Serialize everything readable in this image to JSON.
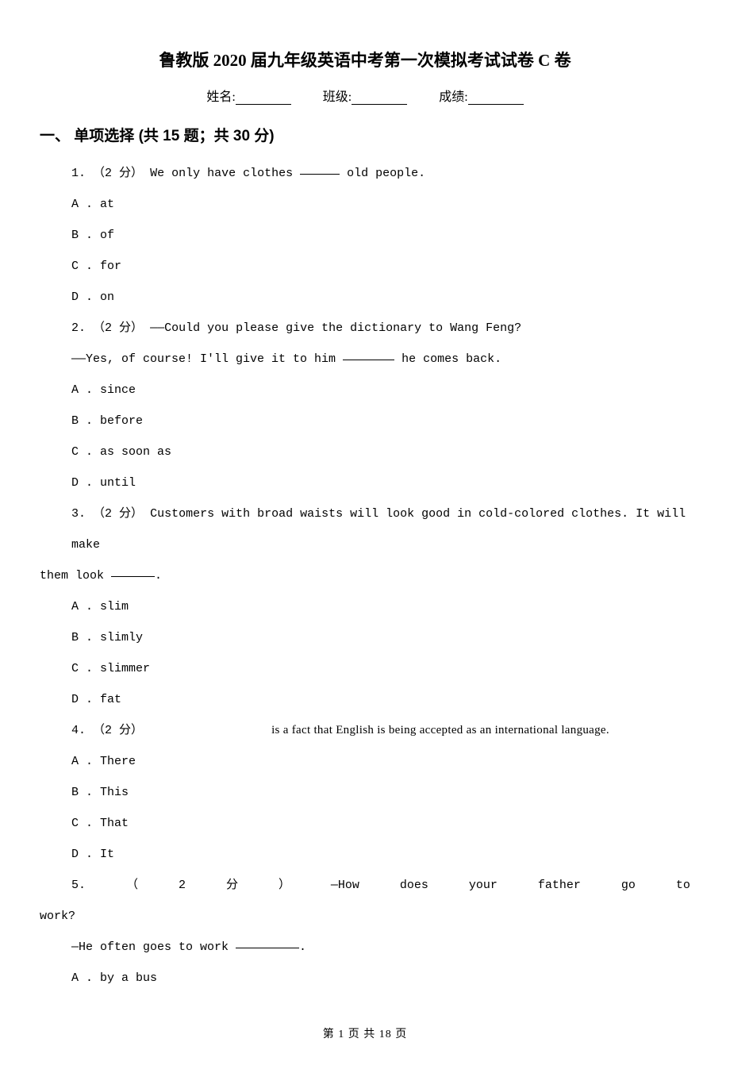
{
  "title": "鲁教版 2020 届九年级英语中考第一次模拟考试试卷 C 卷",
  "info": {
    "name_label": "姓名:",
    "class_label": "班级:",
    "score_label": "成绩:"
  },
  "section": {
    "number": "一、",
    "title": "单项选择 (共 15 题；共 30 分)"
  },
  "questions": [
    {
      "num": "1.",
      "points": "（2 分）",
      "text_before": "We only have clothes ",
      "text_after": " old people.",
      "options": {
        "a": "A . at",
        "b": "B . of",
        "c": "C . for",
        "d": "D . on"
      }
    },
    {
      "num": "2.",
      "points": "（2 分）",
      "text": "——Could you please give the dictionary to Wang Feng?",
      "line2_before": "——Yes, of course! I'll give it to him ",
      "line2_after": " he comes back.",
      "options": {
        "a": "A . since",
        "b": "B . before",
        "c": "C . as soon as",
        "d": "D . until"
      }
    },
    {
      "num": "3.",
      "points": "（2 分）",
      "text": "Customers with broad waists will look good in cold-colored clothes. It will make",
      "line2_before": "them look ",
      "line2_after": ".",
      "options": {
        "a": "A . slim",
        "b": "B . slimly",
        "c": "C . slimmer",
        "d": "D . fat"
      }
    },
    {
      "num": "4.",
      "points": "（2 分）",
      "text": "is a fact that English is being accepted as an international language.",
      "options": {
        "a": "A . There",
        "b": "B . This",
        "c": "C . That",
        "d": "D . It"
      }
    },
    {
      "num": "5.",
      "points_open": "（",
      "points_num": "2",
      "points_unit": "分",
      "points_close": "）",
      "w1": "—How",
      "w2": "does",
      "w3": "your",
      "w4": "father",
      "w5": "go",
      "w6": "to",
      "line2": "work?",
      "line3_before": "—He often goes to work ",
      "line3_after": ".",
      "options": {
        "a": "A . by a bus"
      }
    }
  ],
  "footer": {
    "prefix": "第 ",
    "current": "1",
    "mid": " 页 共 ",
    "total": "18",
    "suffix": " 页"
  }
}
